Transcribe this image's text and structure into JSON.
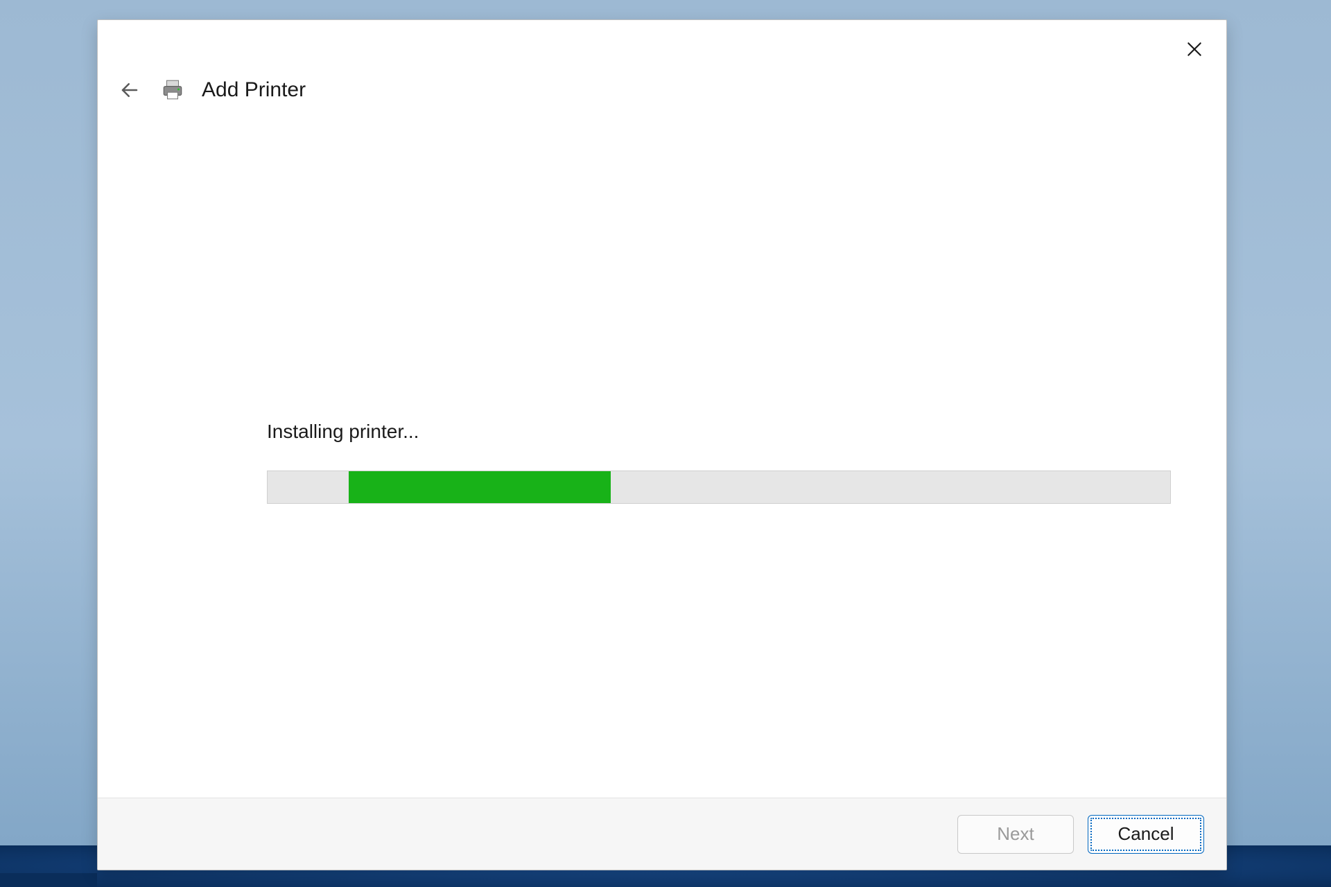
{
  "dialog": {
    "title": "Add Printer",
    "status_text": "Installing printer...",
    "progress": {
      "offset_pct": 9,
      "width_pct": 29
    },
    "buttons": {
      "next_label": "Next",
      "cancel_label": "Cancel",
      "next_enabled": false,
      "cancel_focused": true
    }
  }
}
